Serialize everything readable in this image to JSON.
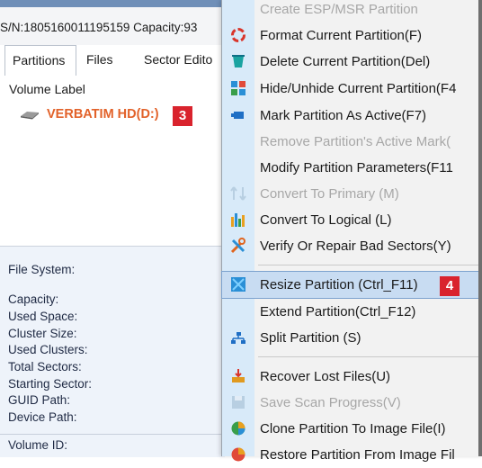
{
  "disk": {
    "serial_capacity": "S/N:1805160011195159  Capacity:93"
  },
  "tabs": [
    "Partitions",
    "Files",
    "Sector Edito"
  ],
  "columns": {
    "volume_label": "Volume Label"
  },
  "volume": {
    "label": "VERBATIM HD(D:)",
    "badge": "3"
  },
  "info_labels": [
    "File System:",
    "Capacity:",
    "Used Space:",
    "Cluster Size:",
    "Used Clusters:",
    "Total Sectors:",
    "Starting Sector:",
    "GUID Path:",
    "Device Path:",
    "Volume ID:"
  ],
  "menu": {
    "items": [
      {
        "label": "Create ESP/MSR Partition",
        "icon": "partition-create-icon",
        "disabled": true
      },
      {
        "label": "Format Current Partition(F)",
        "icon": "format-icon"
      },
      {
        "label": "Delete Current Partition(Del)",
        "icon": "delete-icon"
      },
      {
        "label": "Hide/Unhide Current Partition(F4",
        "icon": "hide-icon"
      },
      {
        "label": "Mark Partition As Active(F7)",
        "icon": "mark-active-icon"
      },
      {
        "label": "Remove Partition's Active Mark(",
        "icon": "",
        "disabled": true
      },
      {
        "label": "Modify Partition Parameters(F11",
        "icon": ""
      },
      {
        "label": "Convert To Primary (M)",
        "icon": "convert-primary-icon",
        "disabled": true
      },
      {
        "label": "Convert To Logical (L)",
        "icon": "convert-logical-icon"
      },
      {
        "label": "Verify Or Repair Bad Sectors(Y)",
        "icon": "repair-icon"
      },
      {
        "label": "Resize Partition (Ctrl_F11)",
        "icon": "resize-icon",
        "highlighted": true
      },
      {
        "label": "Extend Partition(Ctrl_F12)",
        "icon": ""
      },
      {
        "label": "Split Partition (S)",
        "icon": "split-icon"
      },
      {
        "label": "Recover Lost Files(U)",
        "icon": "recover-icon"
      },
      {
        "label": "Save Scan Progress(V)",
        "icon": "save-icon",
        "disabled": true
      },
      {
        "label": "Clone Partition To Image File(I)",
        "icon": "clone-icon"
      },
      {
        "label": "Restore Partition From Image Fil",
        "icon": "restore-icon"
      }
    ],
    "badge": "4"
  },
  "colors": {
    "accent_orange": "#e2622a",
    "badge_red": "#d9232d",
    "menu_gutter": "#d8eaf9",
    "menu_highlight": "#c8dcf2"
  }
}
